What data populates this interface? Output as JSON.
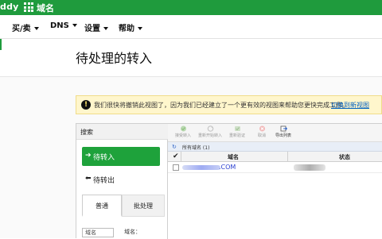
{
  "topbar": {
    "brand_tail": "ddy",
    "app_title": "域名",
    "color": "#1f9b3d"
  },
  "nav": {
    "items": [
      {
        "label": "买/卖"
      },
      {
        "label": "DNS"
      },
      {
        "label": "设置"
      },
      {
        "label": "帮助"
      }
    ]
  },
  "page": {
    "title": "待处理的转入"
  },
  "alert": {
    "text": "我们很快将撤销此视图了，因为我们已经建立了一个更有效的视图来帮助您更快完成工作。",
    "link": "切换到新视图"
  },
  "sidebar": {
    "search_label": "搜索",
    "items": [
      {
        "label": "待转入",
        "active": true
      },
      {
        "label": "待转出",
        "active": false
      }
    ],
    "tabs": [
      {
        "label": "普通"
      },
      {
        "label": "批处理"
      }
    ],
    "mini_input_value": "域名",
    "mini_label": "域名："
  },
  "toolbar": {
    "buttons": [
      {
        "label": "接受转入",
        "icon": "accept-icon",
        "enabled": false
      },
      {
        "label": "重新开始转入",
        "icon": "restart-icon",
        "enabled": false
      },
      {
        "label": "重新验证",
        "icon": "verify-icon",
        "enabled": false
      },
      {
        "label": "取消",
        "icon": "cancel-icon",
        "enabled": false
      },
      {
        "label": "导出列表",
        "icon": "export-icon",
        "enabled": true
      }
    ]
  },
  "table": {
    "group_label": "所有域名 (1)",
    "columns": {
      "check": "✔",
      "name": "域名",
      "status": "状态"
    },
    "rows": [
      {
        "domain_visible": ".COM",
        "status_visible": ""
      }
    ]
  }
}
